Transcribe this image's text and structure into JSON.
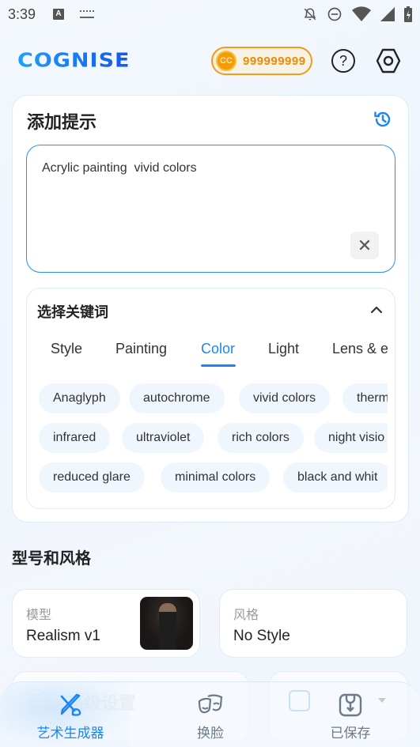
{
  "status_bar": {
    "time": "3:39",
    "left_icons": [
      "a-notification-icon",
      "keyboard-icon"
    ],
    "right_icons": [
      "bell-off-icon",
      "do-not-disturb-icon",
      "wifi-icon",
      "signal-icon",
      "battery-charging-icon"
    ]
  },
  "header": {
    "logo": "COGNISE",
    "coin_symbol": "CC",
    "coin_count": "999999999",
    "help_icon": "?",
    "colors": {
      "brand": "#1677ff",
      "coin": "#ef8a00"
    }
  },
  "prompt": {
    "title": "添加提示",
    "value": "Acrylic painting  vivid colors",
    "clear_icon": "✕"
  },
  "keywords": {
    "title": "选择关键词",
    "tabs": [
      {
        "label": "Style"
      },
      {
        "label": "Painting"
      },
      {
        "label": "Color",
        "active": true
      },
      {
        "label": "Light"
      },
      {
        "label": "Lens & e"
      }
    ],
    "chip_rows": [
      [
        "Anaglyph",
        "autochrome",
        "vivid colors",
        "therm"
      ],
      [
        "infrared",
        "ultraviolet",
        "rich colors",
        "night visio"
      ],
      [
        "reduced glare",
        "minimal colors",
        "black and whit"
      ]
    ]
  },
  "model_style": {
    "title": "型号和风格",
    "model_label": "模型",
    "model_value": "Realism v1",
    "style_label": "风格",
    "style_value": "No Style"
  },
  "advanced": {
    "label": "高级设置"
  },
  "bottom_nav": {
    "items": [
      {
        "label": "艺术生成器",
        "active": true
      },
      {
        "label": "换脸"
      },
      {
        "label": "已保存"
      }
    ],
    "colors": {
      "active": "#1a86f5",
      "inactive": "#6d7a88"
    }
  }
}
